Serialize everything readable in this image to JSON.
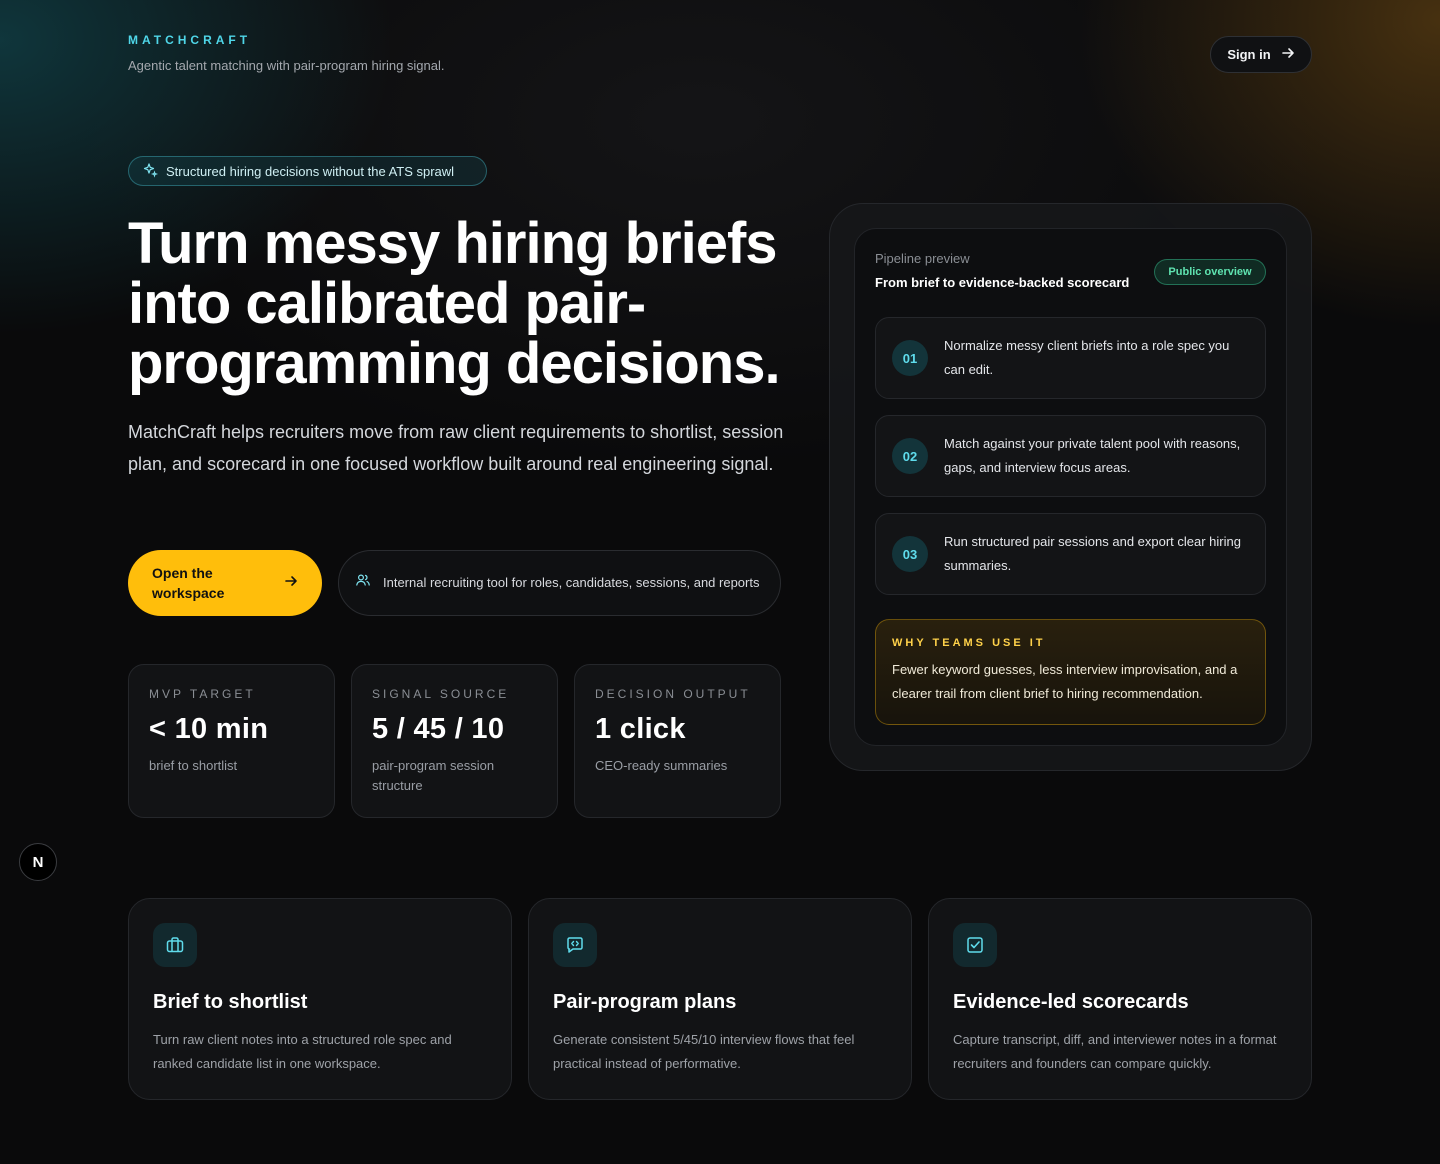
{
  "header": {
    "brand": "MATCHCRAFT",
    "tagline": "Agentic talent matching with pair-program hiring signal.",
    "sign_in": "Sign in"
  },
  "hero": {
    "pill": "Structured hiring decisions without the ATS sprawl",
    "title": "Turn messy hiring briefs into calibrated pair-programming decisions.",
    "description": "MatchCraft helps recruiters move from raw client requirements to shortlist, session plan, and scorecard in one focused workflow built around real engineering signal.",
    "cta": "Open the workspace",
    "note": "Internal recruiting tool for roles, candidates, sessions, and reports"
  },
  "stats": [
    {
      "label": "MVP TARGET",
      "value": "< 10 min",
      "sub": "brief to shortlist"
    },
    {
      "label": "SIGNAL SOURCE",
      "value": "5 / 45 / 10",
      "sub": "pair-program session structure"
    },
    {
      "label": "DECISION OUTPUT",
      "value": "1 click",
      "sub": "CEO-ready summaries"
    }
  ],
  "preview": {
    "kicker": "Pipeline preview",
    "title": "From brief to evidence-backed scorecard",
    "badge": "Public overview",
    "steps": [
      {
        "num": "01",
        "text": "Normalize messy client briefs into a role spec you can edit."
      },
      {
        "num": "02",
        "text": "Match against your private talent pool with reasons, gaps, and interview focus areas."
      },
      {
        "num": "03",
        "text": "Run structured pair sessions and export clear hiring summaries."
      }
    ],
    "why_heading": "WHY TEAMS USE IT",
    "why_body": "Fewer keyword guesses, less interview improvisation, and a clearer trail from client brief to hiring recommendation."
  },
  "corner_badge": "N",
  "features": [
    {
      "icon": "briefcase-icon",
      "title": "Brief to shortlist",
      "desc": "Turn raw client notes into a structured role spec and ranked candidate list in one workspace."
    },
    {
      "icon": "code-message-icon",
      "title": "Pair-program plans",
      "desc": "Generate consistent 5/45/10 interview flows that feel practical instead of performative."
    },
    {
      "icon": "checkbox-icon",
      "title": "Evidence-led scorecards",
      "desc": "Capture transcript, diff, and interviewer notes in a format recruiters and founders can compare quickly."
    }
  ],
  "colors": {
    "accent": "#4fd6e8",
    "cta": "#ffbe0b",
    "success": "#5fe3b0"
  }
}
